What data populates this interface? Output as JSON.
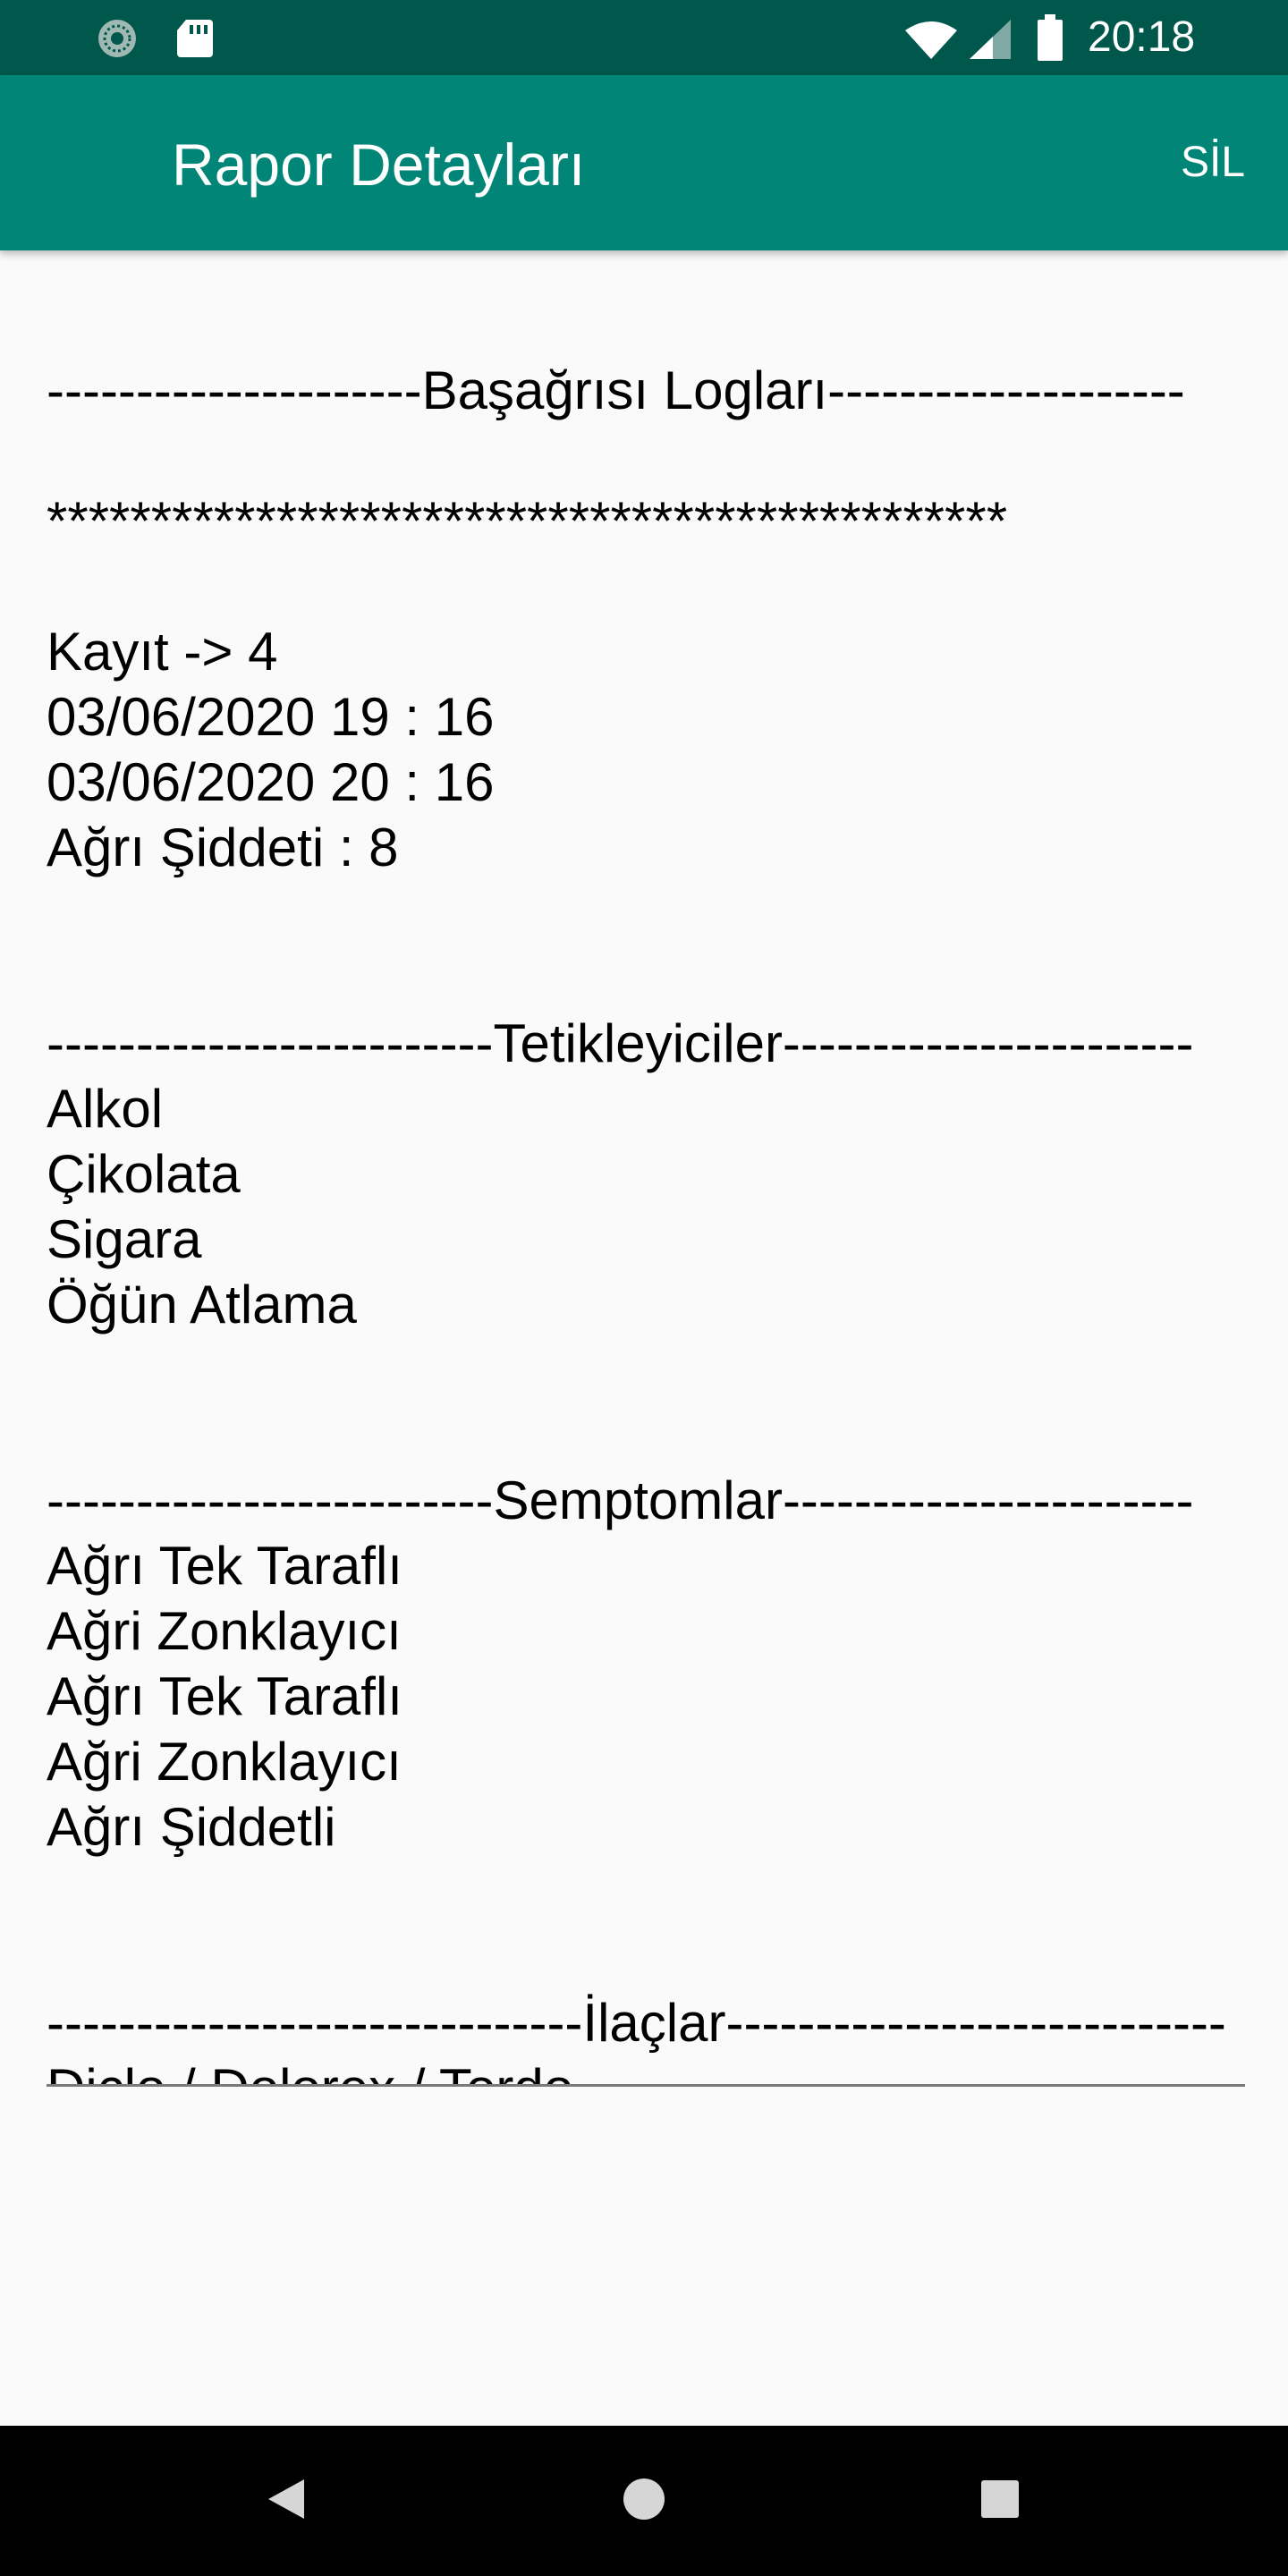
{
  "status_bar": {
    "time": "20:18",
    "icons": [
      "sync-icon",
      "sd-card-icon",
      "wifi-icon",
      "cell-signal-icon",
      "battery-icon"
    ],
    "background": "#00574b"
  },
  "app_bar": {
    "title": "Rapor Detayları",
    "action_label": "SİL",
    "background": "#008577"
  },
  "report": {
    "header_line": "---------------------Başağrısı Logları--------------------",
    "stars_line": "**********************************************",
    "record_line": "Kayıt -> 4",
    "start_time": "03/06/2020 19 : 16",
    "end_time": "03/06/2020 20 : 16",
    "severity": "Ağrı Şiddeti : 8",
    "triggers_header": "-------------------------Tetikleyiciler-----------------------",
    "triggers": [
      "Alkol",
      "Çikolata",
      "Sigara",
      "Öğün Atlama"
    ],
    "symptoms_header": "-------------------------Semptomlar-----------------------",
    "symptoms": [
      "Ağrı Tek Taraflı",
      "Ağri Zonklayıcı",
      "Ağrı Tek Taraflı",
      "Ağri Zonklayıcı",
      "Ağrı Şiddetli"
    ],
    "medications_header": "------------------------------İlaçlar----------------------------",
    "medications_partial": "Diclo / Dolorex / Tordo"
  },
  "nav_bar": {
    "buttons": [
      "back-icon",
      "home-icon",
      "recents-icon"
    ]
  }
}
